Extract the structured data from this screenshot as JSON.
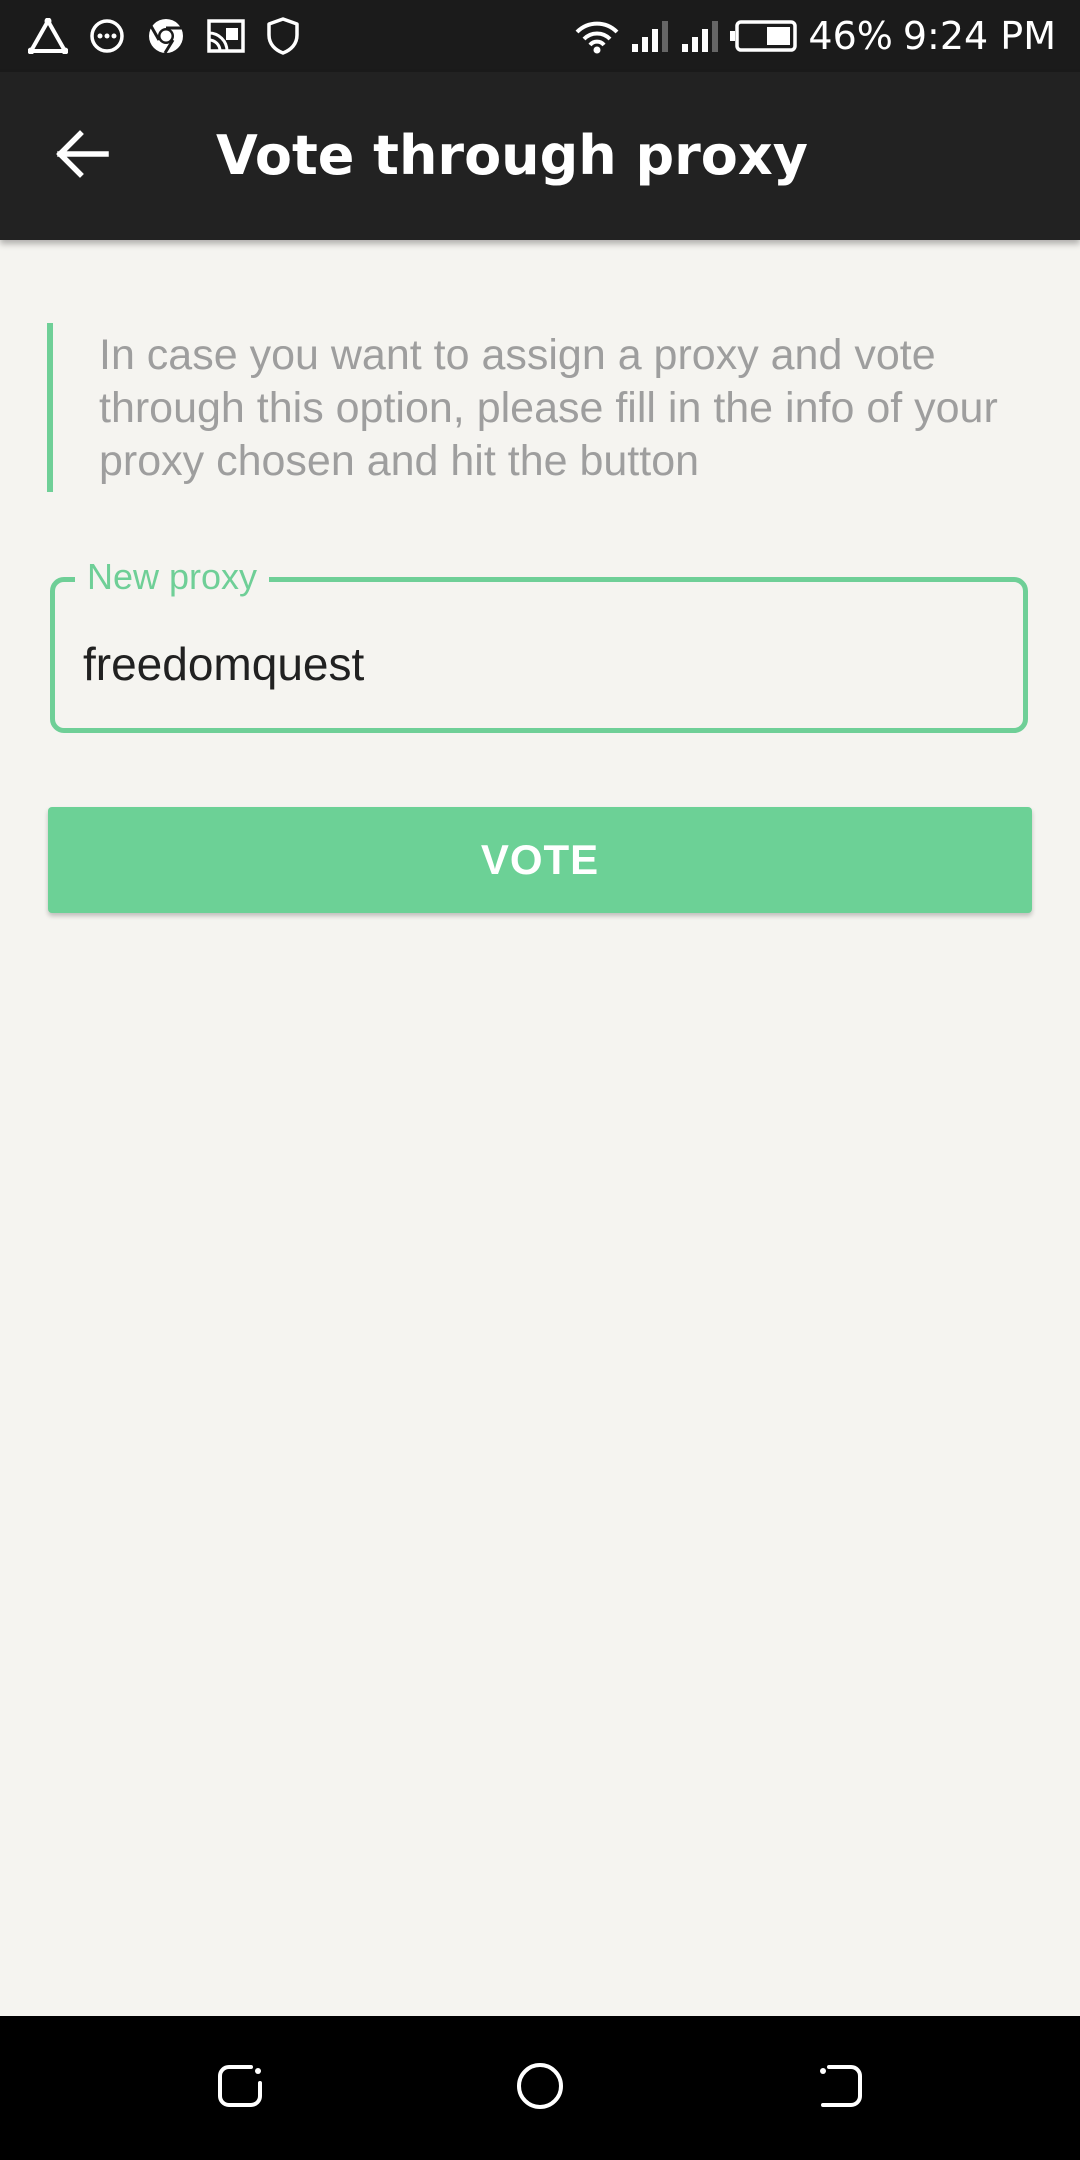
{
  "status_bar": {
    "battery": "46%",
    "time": "9:24 PM",
    "left_icons": [
      "triangle-icon",
      "chat-icon",
      "chrome-icon",
      "cast-icon",
      "shield-icon"
    ],
    "right_icons": [
      "wifi-icon",
      "signal-icon",
      "signal-icon",
      "battery-icon"
    ]
  },
  "app_bar": {
    "title": "Vote through proxy",
    "back_icon": "arrow-left-icon"
  },
  "info": {
    "text": "In case you want to assign a proxy and vote through this option, please fill in the info of your proxy chosen and hit the button"
  },
  "proxy_field": {
    "label": "New proxy",
    "value": "freedomquest"
  },
  "vote_button": {
    "label": "VOTE"
  },
  "colors": {
    "accent": "#6fcf97",
    "app_bar": "#222222",
    "background": "#f5f4f0",
    "info_text": "#9e9e9e"
  },
  "nav_bar": {
    "icons": [
      "recent-apps-icon",
      "home-icon",
      "back-icon"
    ]
  }
}
